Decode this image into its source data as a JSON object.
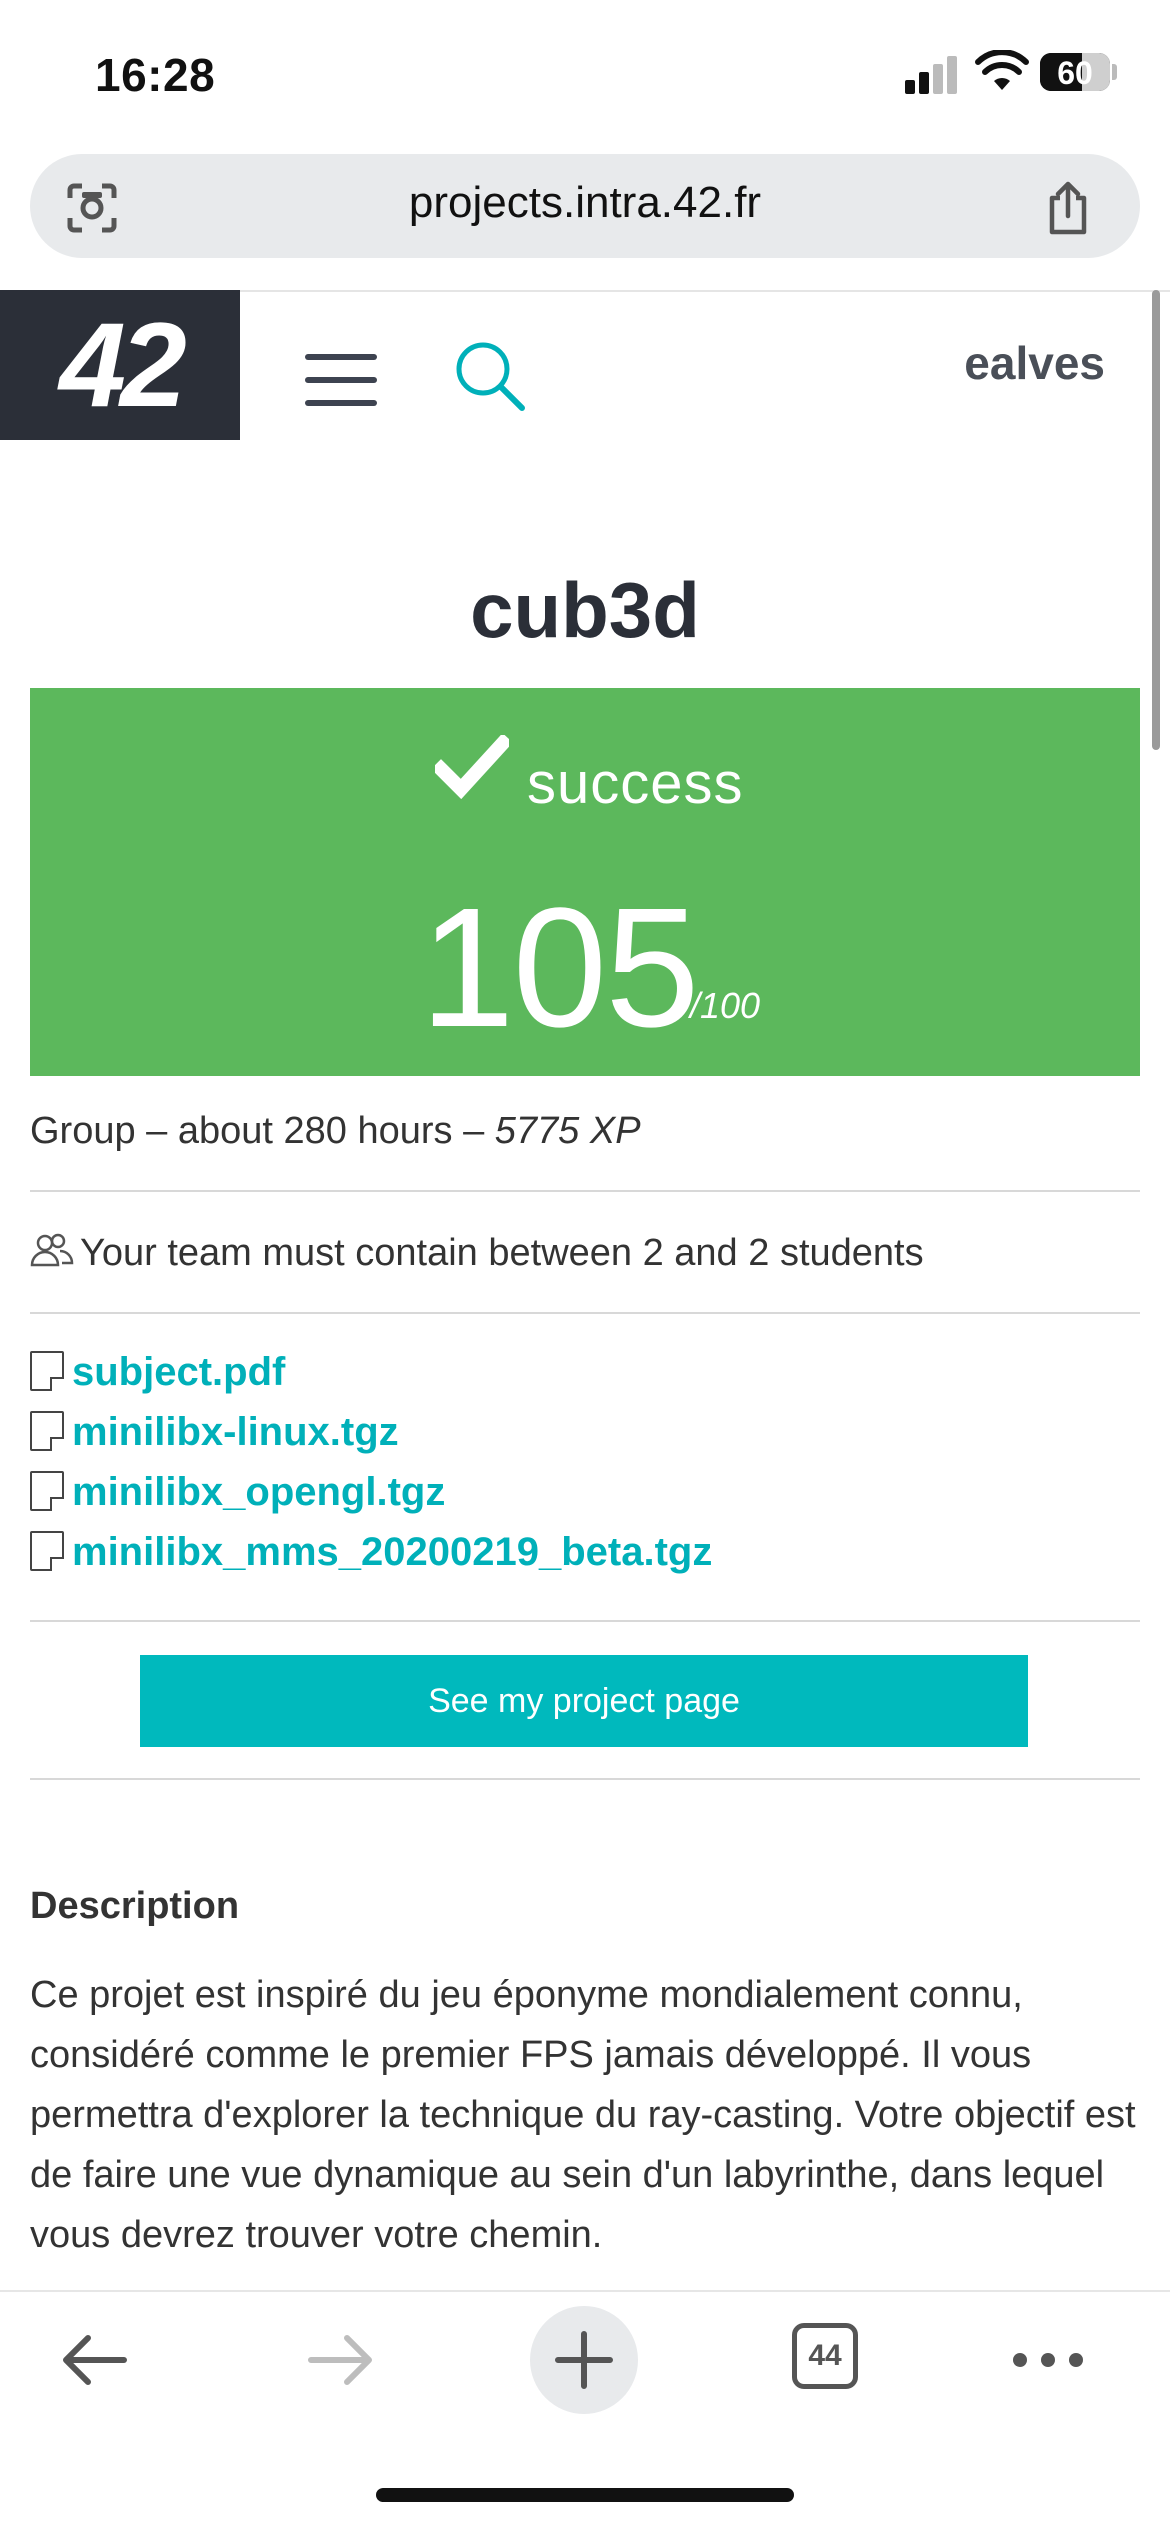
{
  "status_bar": {
    "time": "16:28",
    "battery": "60"
  },
  "browser": {
    "url": "projects.intra.42.fr"
  },
  "header": {
    "logo": "42",
    "username": "ealves"
  },
  "project": {
    "title": "cub3d",
    "status": "success",
    "score": "105",
    "score_max": "/100",
    "meta_prefix": "Group – about 280 hours – ",
    "meta_xp": "5775 XP",
    "team_rule": "Your team must contain between 2 and 2 students",
    "files": [
      "subject.pdf",
      "minilibx-linux.tgz",
      "minilibx_opengl.tgz",
      "minilibx_mms_20200219_beta.tgz"
    ],
    "project_button": "See my project page",
    "description_title": "Description",
    "description": "Ce projet est inspiré du jeu éponyme mondialement connu, considéré comme le premier FPS jamais développé. Il vous permettra d'explorer la technique du ray-casting. Votre objectif est de faire une vue dynamique au sein d'un labyrinthe, dans lequel vous devrez trouver votre chemin."
  },
  "toolbar": {
    "tab_count": "44"
  },
  "colors": {
    "success": "#5cb85c",
    "accent": "#00b9bd",
    "header_dark": "#2b2f38"
  }
}
